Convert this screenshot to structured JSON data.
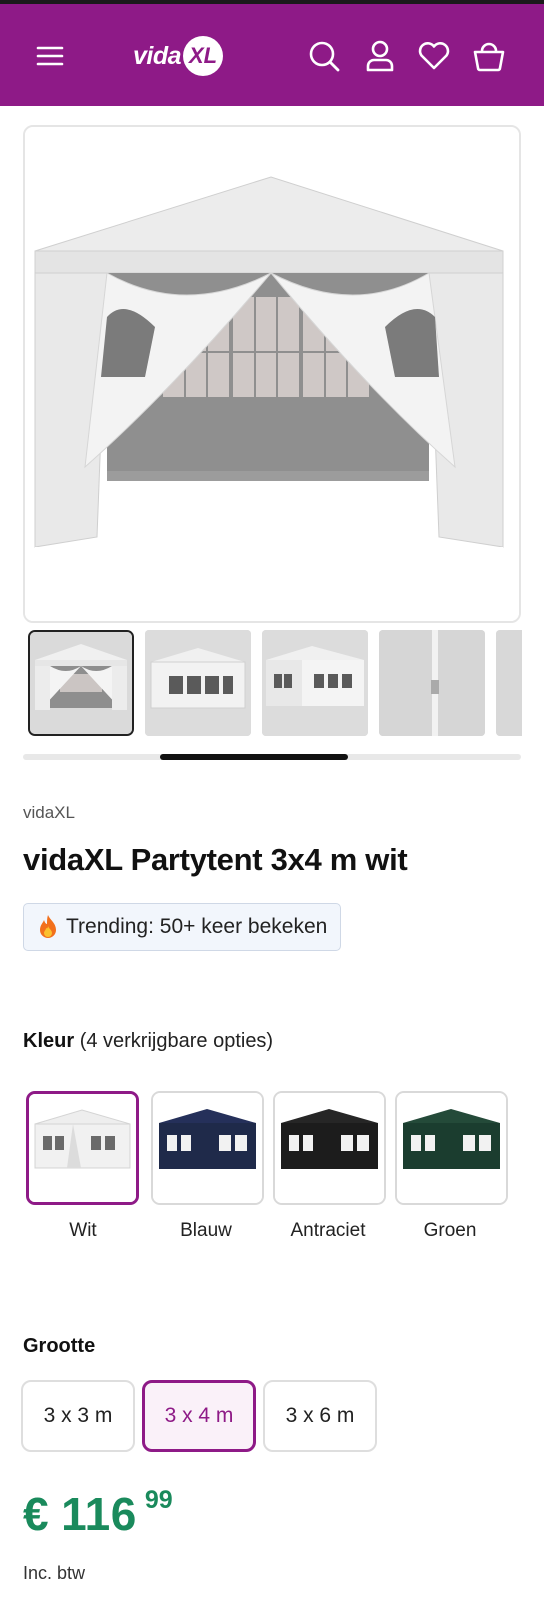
{
  "header": {
    "menu_icon": "hamburger-menu-icon",
    "logo_text": "vida",
    "logo_badge": "XL",
    "icons": [
      "search-icon",
      "account-icon",
      "heart-icon",
      "cart-icon"
    ]
  },
  "gallery": {
    "main_image": "white-party-tent",
    "thumbnails": [
      "tent-front-open",
      "tent-front-closed",
      "tent-angle",
      "tent-detail-pole",
      "tent-partial"
    ]
  },
  "product": {
    "brand": "vidaXL",
    "title": "vidaXL Partytent 3x4 m wit",
    "trending": "Trending: 50+ keer bekeken",
    "trending_icon": "fire-icon"
  },
  "color": {
    "heading": "Kleur",
    "count_text": "(4 verkrijgbare opties)",
    "options": [
      {
        "label": "Wit",
        "swatch": "#f1f1f1",
        "selected": true
      },
      {
        "label": "Blauw",
        "swatch": "#1f2a4a",
        "selected": false
      },
      {
        "label": "Antraciet",
        "swatch": "#1c1c1c",
        "selected": false
      },
      {
        "label": "Groen",
        "swatch": "#1b3d2f",
        "selected": false
      }
    ]
  },
  "size": {
    "heading": "Grootte",
    "options": [
      {
        "label": "3 x 3 m",
        "selected": false
      },
      {
        "label": "3 x 4 m",
        "selected": true
      },
      {
        "label": "3 x 6 m",
        "selected": false
      }
    ]
  },
  "price": {
    "currency": "€",
    "whole": "116",
    "cents": "99",
    "tax_note": "Inc. btw"
  },
  "colors": {
    "brand": "#8e1a87",
    "price": "#1a8a5c"
  }
}
